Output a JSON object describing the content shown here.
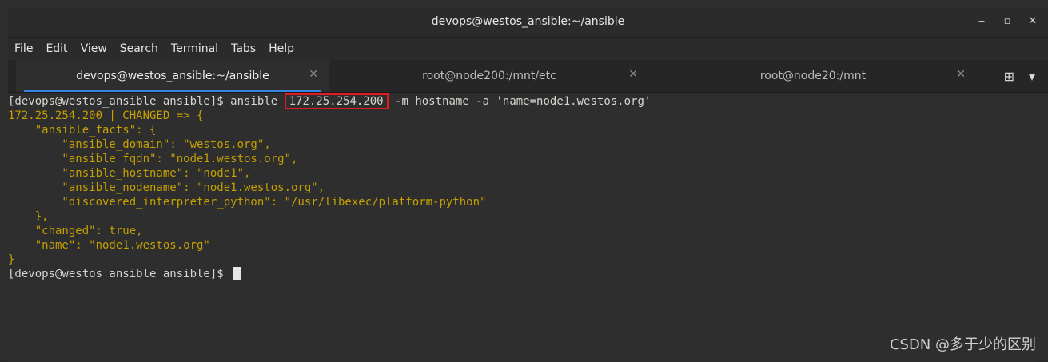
{
  "window": {
    "title": "devops@westos_ansible:~/ansible",
    "controls": [
      "minimize-icon",
      "maximize-icon",
      "close-icon"
    ]
  },
  "menu": {
    "items": [
      "File",
      "Edit",
      "View",
      "Search",
      "Terminal",
      "Tabs",
      "Help"
    ]
  },
  "tabs": [
    {
      "label": "devops@westos_ansible:~/ansible",
      "active": true
    },
    {
      "label": "root@node200:/mnt/etc",
      "active": false
    },
    {
      "label": "root@node20:/mnt",
      "active": false
    }
  ],
  "tab_actions": [
    "new-tab-icon",
    "tab-menu-icon"
  ],
  "terminal": {
    "prompt": "[devops@westos_ansible ansible]$ ",
    "command_prefix": "ansible ",
    "command_host": "172.25.254.200",
    "command_suffix": " -m hostname -a 'name=node1.westos.org'",
    "output": [
      "172.25.254.200 | CHANGED => {",
      "    \"ansible_facts\": {",
      "        \"ansible_domain\": \"westos.org\",",
      "        \"ansible_fqdn\": \"node1.westos.org\",",
      "        \"ansible_hostname\": \"node1\",",
      "        \"ansible_nodename\": \"node1.westos.org\",",
      "        \"discovered_interpreter_python\": \"/usr/libexec/platform-python\"",
      "    },",
      "    \"changed\": true,",
      "    \"name\": \"node1.westos.org\"",
      "}"
    ],
    "final_prompt": "[devops@westos_ansible ansible]$ "
  },
  "colors": {
    "output_yellow": "#c4a000",
    "highlight_red": "#e01b24",
    "tab_accent": "#3584e4"
  },
  "watermark": "CSDN @多于少的区别"
}
